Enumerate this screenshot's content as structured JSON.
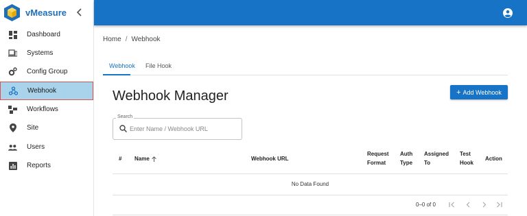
{
  "app": {
    "name": "vMeasure"
  },
  "sidebar": {
    "items": [
      {
        "label": "Dashboard",
        "icon": "dashboard-icon"
      },
      {
        "label": "Systems",
        "icon": "systems-icon"
      },
      {
        "label": "Config Group",
        "icon": "config-group-icon"
      },
      {
        "label": "Webhook",
        "icon": "webhook-icon",
        "active": true
      },
      {
        "label": "Workflows",
        "icon": "workflows-icon"
      },
      {
        "label": "Site",
        "icon": "location-pin-icon"
      },
      {
        "label": "Users",
        "icon": "users-icon"
      },
      {
        "label": "Reports",
        "icon": "reports-icon"
      }
    ]
  },
  "breadcrumb": {
    "home": "Home",
    "separator": "/",
    "current": "Webhook"
  },
  "tabs": [
    {
      "label": "Webhook",
      "active": true
    },
    {
      "label": "File Hook",
      "active": false
    }
  ],
  "page": {
    "title": "Webhook Manager",
    "add_button": "Add Webhook"
  },
  "search": {
    "label": "Search",
    "placeholder": "Enter Name / Webhook URL"
  },
  "table": {
    "columns": {
      "index": "#",
      "name": "Name",
      "url": "Webhook URL",
      "request_format": [
        "Request",
        "Format"
      ],
      "auth_type": [
        "Auth",
        "Type"
      ],
      "assigned_to": [
        "Assigned",
        "To"
      ],
      "test_hook": [
        "Test",
        "Hook"
      ],
      "action": "Action"
    },
    "empty_message": "No Data Found"
  },
  "pagination": {
    "range": "0–0 of 0"
  },
  "colors": {
    "primary": "#1673c6",
    "active_bg": "#a9d3ea",
    "active_border": "#d9534f"
  }
}
